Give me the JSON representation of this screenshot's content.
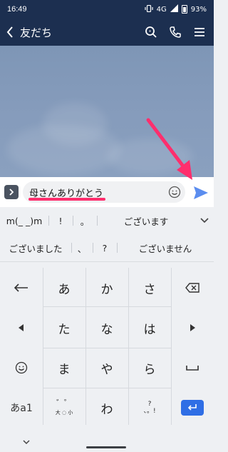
{
  "status_bar": {
    "time": "16:49",
    "network": "4G",
    "battery": "93%"
  },
  "header": {
    "title": "友だち",
    "icons": [
      "back-icon",
      "search-icon",
      "phone-icon",
      "menu-icon"
    ]
  },
  "composer": {
    "input_value": "母さんありがとう",
    "colors": {
      "underline": "#ff2e6d",
      "send": "#5b8def"
    }
  },
  "suggestions": {
    "row1": [
      "m(_ _)m",
      "!",
      "。",
      "ございます"
    ],
    "row2": [
      "ございました",
      "、",
      "?",
      "ございません"
    ]
  },
  "keyboard": {
    "grid": [
      [
        "あ",
        "か",
        "さ"
      ],
      [
        "た",
        "な",
        "は"
      ],
      [
        "ま",
        "や",
        "ら"
      ],
      [
        "",
        "わ",
        ""
      ]
    ],
    "mode_label": "あa1",
    "dakuten_small": "大 ◌ 小"
  },
  "colors": {
    "header_bg": "#1c2f50",
    "enter_key": "#2f6ee5",
    "annotation_arrow": "#ff2e6d"
  }
}
